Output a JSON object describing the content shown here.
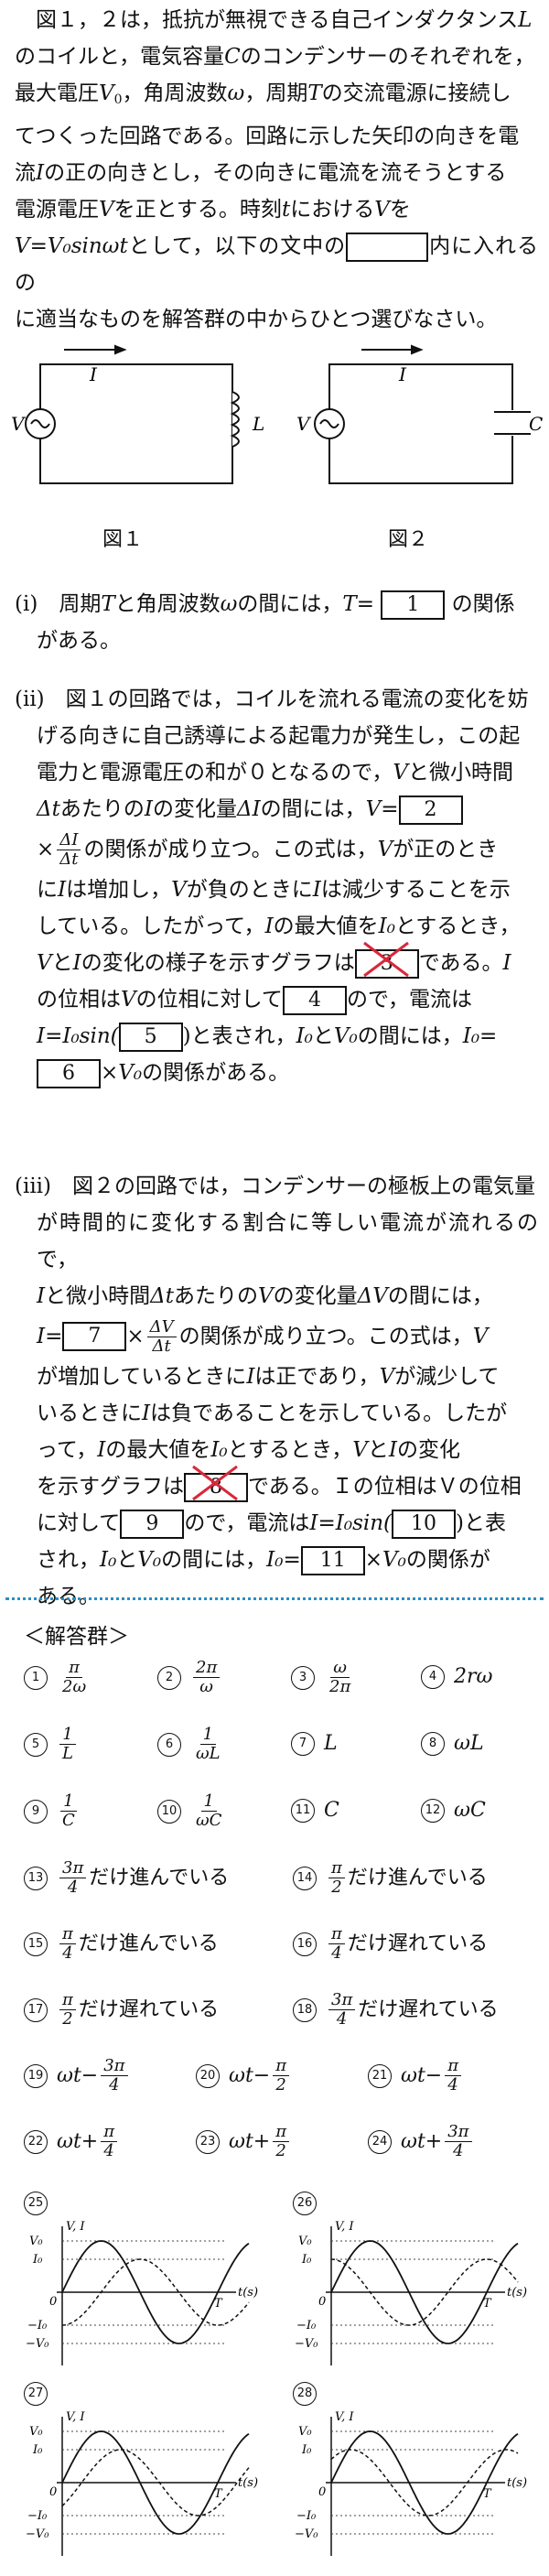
{
  "intro": {
    "line1": "図１，２は，抵抗が無視できる自己インダクタンス",
    "L": "L",
    "line2a": "のコイルと，電気容量",
    "C": "C",
    "line2b": "のコンデンサーのそれぞれを，",
    "line3": "最大電圧",
    "V0": "V",
    "line3b": "，角周波数",
    "omega": "ω",
    "line3c": "，周期",
    "T": "T",
    "line3d": "の交流電源に接続し",
    "line4": "てつくった回路である。回路に示した矢印の向きを電",
    "line5": "流",
    "I": "I",
    "line5b": "の正の向きとし，その向きに電流を流そうとする",
    "line6": "電源電圧",
    "V": "V",
    "line6b": "を正とする。時刻",
    "t": "t",
    "line6c": "における",
    "line6d": "を",
    "line7": "V=V₀sinωt",
    "line7b": "として，以下の文中の",
    "line7c": "内に入れるの",
    "line8": "に適当なものを解答群の中からひとつ選びなさい。"
  },
  "figures": {
    "fig1_caption": "図１",
    "fig2_caption": "図２",
    "fig1_V": "V",
    "fig1_I": "I",
    "fig1_L": "L",
    "fig2_V": "V",
    "fig2_I": "I",
    "fig2_C": "C"
  },
  "q1": {
    "label": "(i)",
    "text_a": "周期",
    "T": "T",
    "text_b": "と角周波数",
    "omega": "ω",
    "text_c": "の間には，",
    "eq": "T=",
    "box": "1",
    "text_d": "の関係",
    "text_e": "がある。"
  },
  "q2": {
    "label": "(ii)",
    "l1": "図１の回路では，コイルを流れる電流の変化を妨",
    "l2": "げる向きに自己誘導による起電力が発生し，この起",
    "l3": "電力と電源電圧の和が０となるので，",
    "l3v": "V",
    "l3b": "と微小時間",
    "l4a": "Δt",
    "l4b": "あたりの",
    "l4c": "I",
    "l4d": "の変化量",
    "l4e": "ΔI",
    "l4f": "の間には，",
    "l4g": "V=",
    "box2": "2",
    "frac_num": "ΔI",
    "frac_den": "Δt",
    "l5a": "の関係が成り立つ。この式は，",
    "l5b": "V",
    "l5c": "が正のとき",
    "l6a": "に",
    "l6b": "I",
    "l6c": "は増加し，",
    "l6d": "V",
    "l6e": "が負のときに",
    "l6f": "I",
    "l6g": "は減少することを示",
    "l7a": "している。したがって，",
    "l7b": "I",
    "l7c": "の最大値を",
    "l7d": "I₀",
    "l7e": "とするとき，",
    "l8a": "V",
    "l8b": "と",
    "l8c": "I",
    "l8d": "の変化の様子を示すグラフは",
    "box3": "3",
    "l8e": "である。",
    "l8f": "I",
    "l9a": "の位相は",
    "l9b": "V",
    "l9c": "の位相に対して",
    "box4": "4",
    "l9d": "ので，電流は",
    "l10a": "I=I₀sin(",
    "box5": "5",
    "l10b": ")と表され，",
    "l10c": "I₀",
    "l10d": "と",
    "l10e": "V₀",
    "l10f": "の間には，",
    "l10g": "I₀=",
    "box6": "6",
    "l11a": "×",
    "l11b": "V₀",
    "l11c": "の関係がある。"
  },
  "q3": {
    "label": "(iii)",
    "l1": "図２の回路では，コンデンサーの極板上の電気量",
    "l2": "が時間的に変化する割合に等しい電流が流れるので，",
    "l3a": "I",
    "l3b": "と微小時間",
    "l3c": "Δt",
    "l3d": "あたりの",
    "l3e": "V",
    "l3f": "の変化量",
    "l3g": "ΔV",
    "l3h": "の間には，",
    "l4a": "I=",
    "box7": "7",
    "l4b": "×",
    "frac_num": "ΔV",
    "frac_den": "Δt",
    "l4c": "の関係が成り立つ。この式は，",
    "l4d": "V",
    "l5a": "が増加しているときに",
    "l5b": "I",
    "l5c": "は正であり，",
    "l5d": "V",
    "l5e": "が減少して",
    "l6a": "いるときに",
    "l6b": "I",
    "l6c": "は負であることを示している。したが",
    "l7a": "って，",
    "l7b": "I",
    "l7c": "の最大値を",
    "l7d": "I₀",
    "l7e": "とするとき，",
    "l7f": "V",
    "l7g": "と",
    "l7h": "I",
    "l7i": "の変化",
    "l8a": "を示すグラフは",
    "box8": "8",
    "l8b": "である。Ｉの位相はＶの位相",
    "l9a": "に対して",
    "box9": "9",
    "l9b": "ので，電流は",
    "l9c": "I=I₀sin(",
    "box10": "10",
    "l9d": ")と表",
    "l10a": "され，",
    "l10b": "I₀",
    "l10c": "と",
    "l10d": "V₀",
    "l10e": "の間には，",
    "l10f": "I₀=",
    "box11": "11",
    "l10g": "×",
    "l10h": "V₀",
    "l10i": "の関係が",
    "l11": "ある。"
  },
  "answers": {
    "heading": "＜解答群＞",
    "items": [
      {
        "n": "1",
        "num": "π",
        "den": "2ω"
      },
      {
        "n": "2",
        "num": "2π",
        "den": "ω"
      },
      {
        "n": "3",
        "num": "ω",
        "den": "2π"
      },
      {
        "n": "4",
        "text": "2rω"
      },
      {
        "n": "5",
        "num": "1",
        "den": "L"
      },
      {
        "n": "6",
        "num": "1",
        "den": "ωL"
      },
      {
        "n": "7",
        "text": "L"
      },
      {
        "n": "8",
        "text": "ωL"
      },
      {
        "n": "9",
        "num": "1",
        "den": "C"
      },
      {
        "n": "10",
        "num": "1",
        "den": "ωC"
      },
      {
        "n": "11",
        "text": "C"
      },
      {
        "n": "12",
        "text": "ωC"
      },
      {
        "n": "13",
        "num": "3π",
        "den": "4",
        "after": "だけ進んでいる"
      },
      {
        "n": "14",
        "num": "π",
        "den": "2",
        "after": "だけ進んでいる"
      },
      {
        "n": "15",
        "num": "π",
        "den": "4",
        "after": "だけ進んでいる"
      },
      {
        "n": "16",
        "num": "π",
        "den": "4",
        "after": "だけ遅れている"
      },
      {
        "n": "17",
        "num": "π",
        "den": "2",
        "after": "だけ遅れている"
      },
      {
        "n": "18",
        "num": "3π",
        "den": "4",
        "after": "だけ遅れている"
      },
      {
        "n": "19",
        "before": "ωt−",
        "num": "3π",
        "den": "4"
      },
      {
        "n": "20",
        "before": "ωt−",
        "num": "π",
        "den": "2"
      },
      {
        "n": "21",
        "before": "ωt−",
        "num": "π",
        "den": "4"
      },
      {
        "n": "22",
        "before": "ωt+",
        "num": "π",
        "den": "4"
      },
      {
        "n": "23",
        "before": "ωt+",
        "num": "π",
        "den": "2"
      },
      {
        "n": "24",
        "before": "ωt+",
        "num": "3π",
        "den": "4"
      }
    ],
    "graph_nums": [
      "25",
      "26",
      "27",
      "28"
    ],
    "graph_axis_y": "V, I",
    "graph_axis_x": "t(s)",
    "graph_V0": "V₀",
    "graph_I0": "I₀",
    "graph_negI0": "−I₀",
    "graph_negV0": "−V₀",
    "graph_T": "T",
    "graph_origin": "0"
  }
}
